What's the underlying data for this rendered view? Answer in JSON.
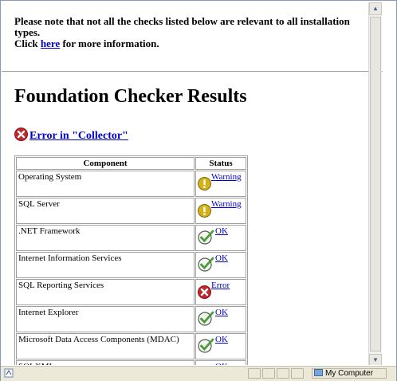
{
  "notice": {
    "line1": "Please note that not all the checks listed below are relevant to all installation types.",
    "click_prefix": "Click ",
    "link": "here",
    "click_suffix": " for more information."
  },
  "title": "Foundation Checker Results",
  "error_link": "Error in \"Collector\"",
  "table": {
    "headers": [
      "Component",
      "Status"
    ],
    "rows": [
      {
        "component": "Operating System",
        "status": "Warning",
        "icon": "warning-icon"
      },
      {
        "component": "SQL Server",
        "status": "Warning",
        "icon": "warning-icon"
      },
      {
        "component": ".NET Framework",
        "status": "OK",
        "icon": "check-icon"
      },
      {
        "component": "Internet Information Services",
        "status": "OK",
        "icon": "check-icon"
      },
      {
        "component": "SQL Reporting Services",
        "status": "Error",
        "icon": "error-icon"
      },
      {
        "component": "Internet Explorer",
        "status": "OK",
        "icon": "check-icon"
      },
      {
        "component": "Microsoft Data Access Components (MDAC)",
        "status": "OK",
        "icon": "check-icon"
      },
      {
        "component": "SQLXML",
        "status": "OK",
        "icon": "check-icon"
      }
    ]
  },
  "statusbar": {
    "zone": "My Computer"
  },
  "colors": {
    "link": "#0000cc",
    "error": "#c0282d",
    "warning": "#d4b21a",
    "ok": "#4a9c3a"
  }
}
